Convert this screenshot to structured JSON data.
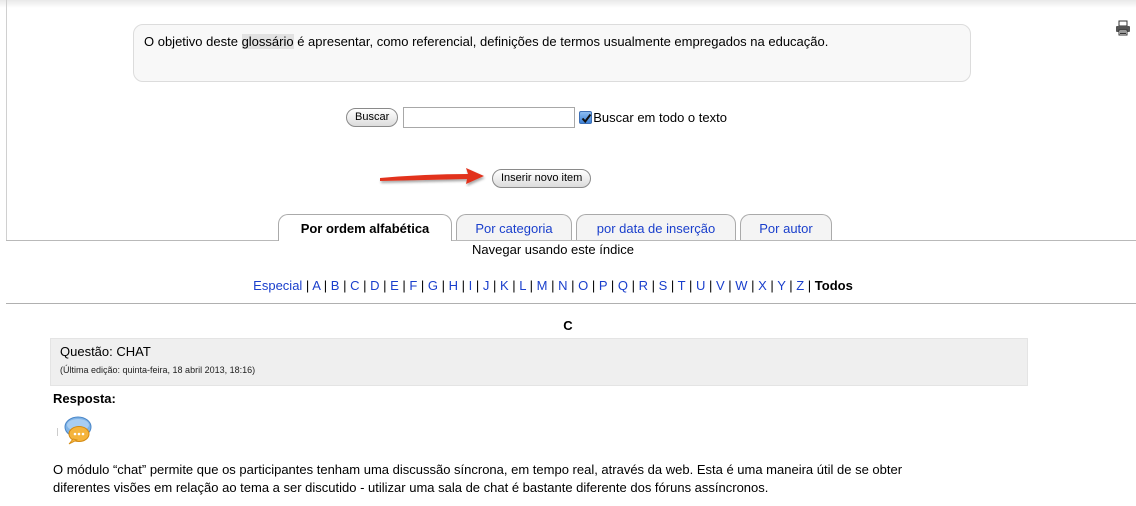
{
  "intro": {
    "before": "O objetivo deste ",
    "highlight": "glossário",
    "after": " é apresentar, como referencial, definições de termos usualmente empregados na educação."
  },
  "search": {
    "button_label": "Buscar",
    "input_value": "",
    "checkbox_checked": true,
    "checkbox_label": "Buscar em todo o texto"
  },
  "insert_button_label": "Inserir novo item",
  "tabs": [
    {
      "label": "Por ordem alfabética",
      "active": true
    },
    {
      "label": "Por categoria",
      "active": false
    },
    {
      "label": "por data de inserção",
      "active": false
    },
    {
      "label": "Por autor",
      "active": false
    }
  ],
  "browse_heading": "Navegar usando este índice",
  "alphabet": {
    "special": "Especial",
    "letters": [
      "A",
      "B",
      "C",
      "D",
      "E",
      "F",
      "G",
      "H",
      "I",
      "J",
      "K",
      "L",
      "M",
      "N",
      "O",
      "P",
      "Q",
      "R",
      "S",
      "T",
      "U",
      "V",
      "W",
      "X",
      "Y",
      "Z"
    ],
    "separator": " | ",
    "all": "Todos"
  },
  "section_letter": "C",
  "entry": {
    "title": "Questão: CHAT",
    "meta": "(Última edição: quinta-feira, 18 abril 2013, 18:16)",
    "answer_label": "Resposta:",
    "icon": "chat-bubbles-icon",
    "answer_line1": "O módulo “chat” permite que os participantes tenham uma discussão síncrona, em tempo real, através da web. Esta é uma maneira útil de se obter",
    "answer_line2": "diferentes visões em relação ao tema a ser discutido - utilizar uma sala de chat é bastante diferente dos fóruns assíncronos."
  },
  "colors": {
    "link": "#1a3fcc",
    "arrow": "#e2321c",
    "entry_header_bg": "#efefef"
  }
}
